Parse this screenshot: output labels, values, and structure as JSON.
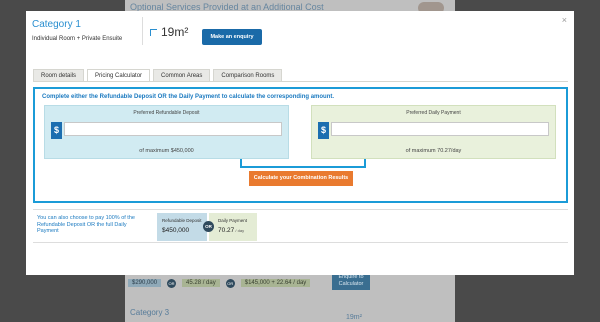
{
  "background": {
    "heading": "Optional Services Provided at an Additional Cost",
    "row": {
      "deposit": "$290,000",
      "or": "OR",
      "payment": "45.28 / day",
      "combo": "$145,000 + 22.64 / day",
      "button": "Enquire to Calculator"
    },
    "category3": "Category 3",
    "size3": "19m²"
  },
  "modal": {
    "close_icon": "×",
    "category_title": "Category 1",
    "category_subtitle": "Individual Room + Private Ensuite",
    "room_size": "19m²",
    "enquiry_button": "Make an enquiry",
    "tabs": [
      {
        "label": "Room details"
      },
      {
        "label": "Pricing Calculator"
      },
      {
        "label": "Common Areas"
      },
      {
        "label": "Comparison Rooms"
      }
    ],
    "calculator": {
      "instruction": "Complete either the Refundable Deposit OR the Daily Payment to calculate the corresponding amount.",
      "deposit": {
        "title": "Preferred Refundable Deposit",
        "currency": "$",
        "value": "",
        "max": "of maximum $450,000"
      },
      "payment": {
        "title": "Preferred Daily Payment",
        "currency": "$",
        "value": "",
        "max": "of maximum 70.27/day"
      },
      "button": "Calculate your Combination Results"
    },
    "summary": {
      "text": "You can also choose to pay 100% of the Refundable Deposit OR the full Daily Payment",
      "deposit_label": "Refundable Deposit",
      "deposit_value": "$450,000",
      "or": "OR",
      "payment_label": "Daily Payment",
      "payment_value": "70.27",
      "payment_unit": " / day"
    }
  },
  "colors": {
    "accent_blue": "#1b9bd7",
    "button_blue": "#1a6aa8",
    "calc_orange": "#e97a2f",
    "deposit_panel": "#d1ebf2",
    "payment_panel": "#e9f1dc"
  }
}
